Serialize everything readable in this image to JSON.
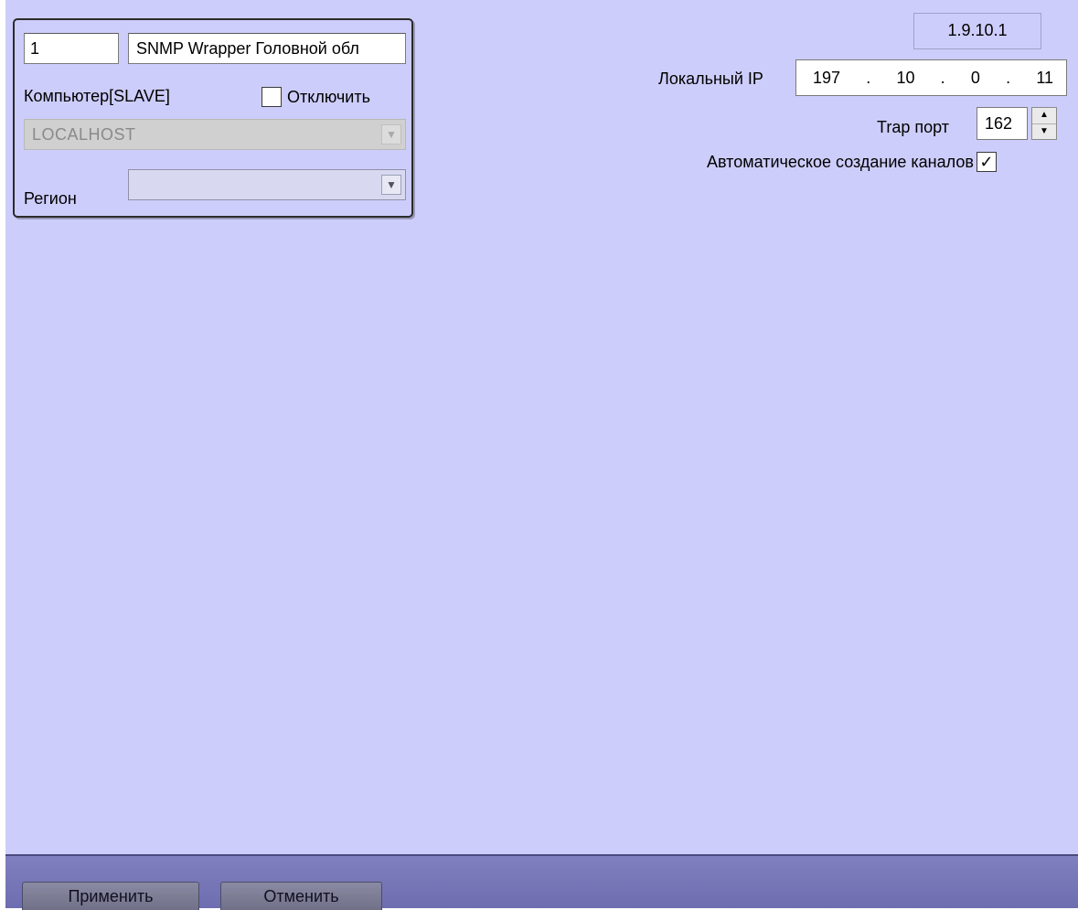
{
  "object_panel": {
    "id_value": "1",
    "name_value": "SNMP Wrapper Головной обл",
    "computer_label": "Компьютер[SLAVE]",
    "disable_label": "Отключить",
    "disable_checked": false,
    "host_value": "LOCALHOST",
    "region_label": "Регион",
    "region_value": ""
  },
  "settings": {
    "version": "1.9.10.1",
    "local_ip_label": "Локальный IP",
    "local_ip": [
      "197",
      "10",
      "0",
      "11"
    ],
    "ip_separator": ".",
    "trap_port_label": "Trap порт",
    "trap_port_value": "162",
    "auto_create_label": "Автоматическое создание каналов",
    "auto_create_checked": true
  },
  "footer": {
    "apply_label": "Применить",
    "cancel_label": "Отменить"
  },
  "colors": {
    "background": "#cdcdfb",
    "footer": "#7474b4"
  }
}
